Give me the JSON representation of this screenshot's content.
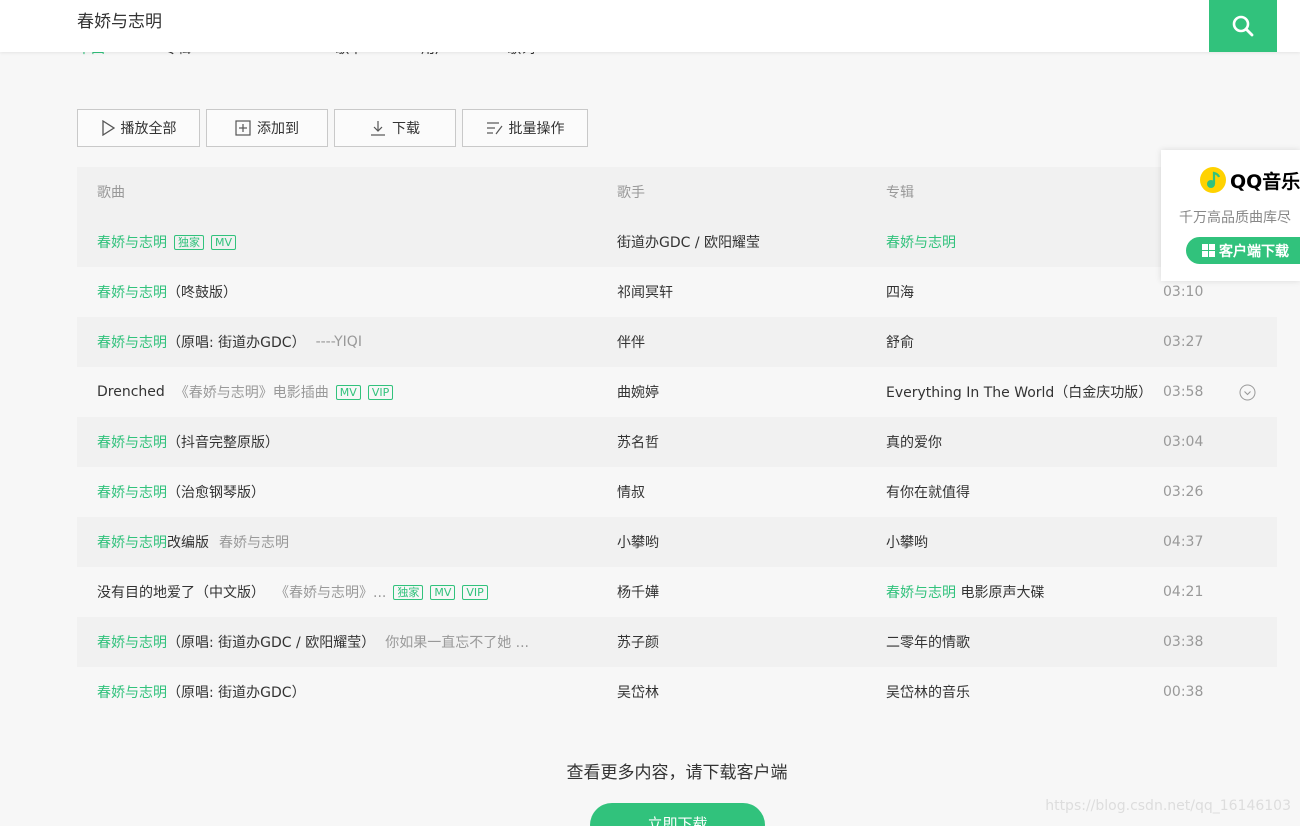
{
  "search": {
    "query": "春娇与志明"
  },
  "tabs": [
    {
      "label": "单曲"
    },
    {
      "label": "专辑"
    },
    {
      "label": "MV"
    },
    {
      "label": "歌单"
    },
    {
      "label": "用户"
    },
    {
      "label": "歌词"
    }
  ],
  "toolbar": {
    "play_all": "播放全部",
    "add_to": "添加到",
    "download": "下载",
    "batch": "批量操作"
  },
  "table": {
    "headers": {
      "song": "歌曲",
      "singer": "歌手",
      "album": "专辑"
    },
    "rows": [
      {
        "title": "春娇与志明",
        "tags": [
          "独家",
          "MV"
        ],
        "singer": "街道办GDC / 欧阳耀莹",
        "album": "春娇与志明",
        "time": ""
      },
      {
        "title": "春娇与志明",
        "suffix": "（咚鼓版）",
        "singer": "祁闻冥轩",
        "album": "四海",
        "time": "03:10"
      },
      {
        "title": "春娇与志明",
        "suffix": "（原唱: 街道办GDC）",
        "sub": "----YIQI",
        "singer": "伴伴",
        "album": "舒俞",
        "time": "03:27"
      },
      {
        "title": "Drenched",
        "sub": "《春娇与志明》电影插曲",
        "tags": [
          "MV",
          "VIP"
        ],
        "singer": "曲婉婷",
        "album": "Everything In The World（白金庆功版）",
        "time": "03:58"
      },
      {
        "title": "春娇与志明",
        "suffix": "（抖音完整原版）",
        "singer": "苏名哲",
        "album": "真的爱你",
        "time": "03:04"
      },
      {
        "title": "春娇与志明",
        "suffix": "（治愈钢琴版）",
        "singer": "情叔",
        "album": "有你在就值得",
        "time": "03:26"
      },
      {
        "title": "春娇与志明",
        "suffix": "改编版",
        "sub": "春娇与志明",
        "singer": "小攀哟",
        "album": "小攀哟",
        "time": "04:37"
      },
      {
        "title": "没有目的地爱了（中文版）",
        "sub": "《春娇与志明》...",
        "tags": [
          "独家",
          "MV",
          "VIP"
        ],
        "singer": "杨千嬅",
        "album": "春娇与志明",
        "album_suffix": " 电影原声大碟",
        "time": "04:21"
      },
      {
        "title": "春娇与志明",
        "suffix": "（原唱: 街道办GDC / 欧阳耀莹）",
        "sub": "你如果一直忘不了她 ...",
        "singer": "苏子颜",
        "album": "二零年的情歌",
        "time": "03:38"
      },
      {
        "title": "春娇与志明",
        "suffix": "（原唱: 街道办GDC）",
        "singer": "吴岱林",
        "album": "吴岱林的音乐",
        "time": "00:38"
      }
    ]
  },
  "promo": {
    "logo": "QQ音乐",
    "text": "千万高品质曲库尽",
    "button": "客户端下载"
  },
  "footer": {
    "tip": "查看更多内容，请下载客户端",
    "button": "立即下载"
  },
  "watermark": "https://blog.csdn.net/qq_16146103",
  "colors": {
    "accent": "#31c27c"
  }
}
